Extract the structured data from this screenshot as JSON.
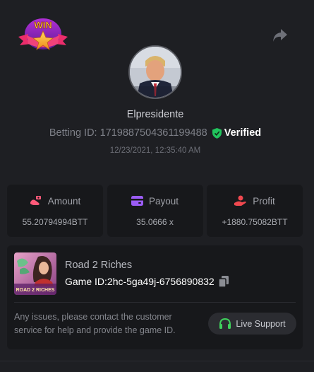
{
  "header": {
    "badge_text": "WIN"
  },
  "profile": {
    "username": "Elpresidente",
    "betting_label": "Betting ID:",
    "betting_id": "1719887504361199488",
    "verified_label": "Verified",
    "datetime": "12/23/2021, 12:35:40 AM"
  },
  "stats": [
    {
      "label": "Amount",
      "value": "55.20794994BTT",
      "icon": "amount-icon",
      "color": "#ff5a7a"
    },
    {
      "label": "Payout",
      "value": "35.0666 x",
      "icon": "wallet-icon",
      "color": "#9b5cf5"
    },
    {
      "label": "Profit",
      "value": "+1880.75082BTT",
      "icon": "profit-hand-icon",
      "color": "#f0484f"
    }
  ],
  "game": {
    "thumb_label": "ROAD 2 RICHES",
    "name": "Road 2 Riches",
    "id_label": "Game ID:",
    "id_value": "2hc-5ga49j-6756890832",
    "help_text": "Any issues, please contact the customer service for help and provide the game ID.",
    "support_label": "Live Support"
  },
  "colors": {
    "background": "#1e1f23",
    "card": "#17181b",
    "verified_green": "#21c55d",
    "support_icon_green": "#3fd15c"
  }
}
